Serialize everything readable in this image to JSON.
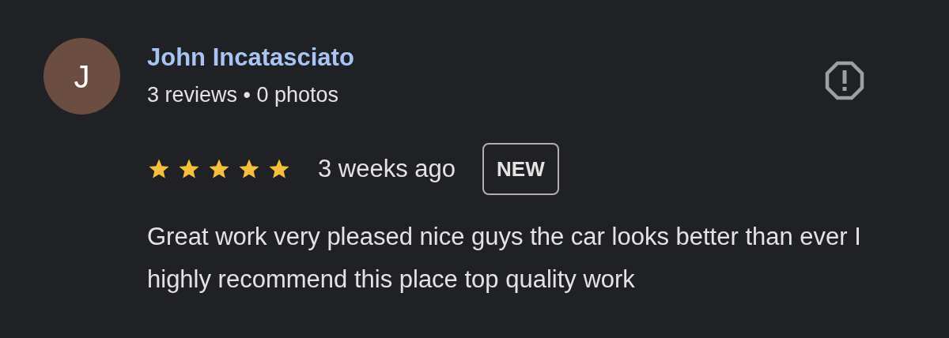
{
  "review": {
    "avatar_letter": "J",
    "author": "John Incatasciato",
    "meta": "3 reviews • 0 photos",
    "stars": 5,
    "time": "3 weeks ago",
    "badge": "NEW",
    "text": "Great work very pleased nice guys the car looks better than ever I highly recommend this place top quality work"
  }
}
